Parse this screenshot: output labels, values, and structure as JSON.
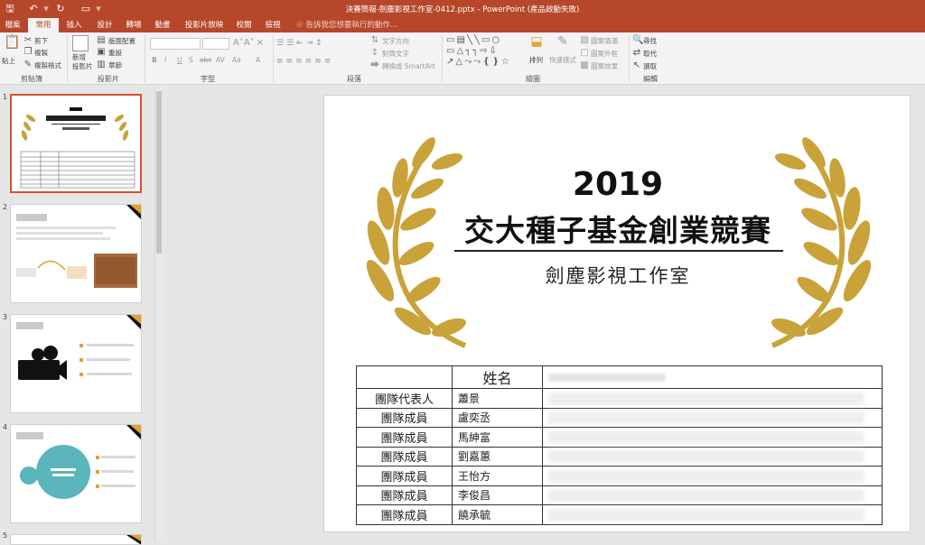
{
  "titlebar": {
    "title": "決賽簡報-劍塵影視工作室-0412.pptx - PowerPoint (產品啟動失敗)",
    "quick_access": [
      "save-icon",
      "undo-icon",
      "redo-icon",
      "start-from-beginning-icon"
    ]
  },
  "tabs": [
    {
      "label": "檔案",
      "active": false
    },
    {
      "label": "常用",
      "active": true
    },
    {
      "label": "插入",
      "active": false
    },
    {
      "label": "設計",
      "active": false
    },
    {
      "label": "轉場",
      "active": false
    },
    {
      "label": "動畫",
      "active": false
    },
    {
      "label": "投影片放映",
      "active": false
    },
    {
      "label": "校閱",
      "active": false
    },
    {
      "label": "檢視",
      "active": false
    }
  ],
  "tell_me": "告訴我您想要執行的動作...",
  "ribbon": {
    "clipboard": {
      "paste": "貼上",
      "cut": "剪下",
      "copy": "複製",
      "format_painter": "複製格式",
      "label": "剪貼簿"
    },
    "slides": {
      "new_slide": "新增\n投影片",
      "layout": "版面配置",
      "reset": "重設",
      "section": "章節",
      "label": "投影片"
    },
    "font": {
      "bold": "B",
      "italic": "I",
      "underline": "U",
      "shadow": "S",
      "strike": "abc",
      "spacing": "AV",
      "case": "Aa",
      "color": "A",
      "label": "字型"
    },
    "paragraph": {
      "text_direction": "文字方向",
      "align_text": "對齊文字",
      "smartart": "轉換成 SmartArt",
      "label": "段落"
    },
    "drawing": {
      "arrange": "排列",
      "quick_styles": "快速樣式",
      "shape_fill": "圖案填滿",
      "shape_outline": "圖案外框",
      "shape_effects": "圖案效果",
      "label": "繪圖"
    },
    "editing": {
      "find": "尋找",
      "replace": "取代",
      "select": "選取",
      "label": "編輯"
    }
  },
  "thumbnails": [
    {
      "num": "1",
      "selected": true
    },
    {
      "num": "2",
      "selected": false
    },
    {
      "num": "3",
      "selected": false
    },
    {
      "num": "4",
      "selected": false
    },
    {
      "num": "5",
      "selected": false
    }
  ],
  "slide": {
    "year": "2019",
    "title": "交大種子基金創業競賽",
    "subtitle": "劍塵影視工作室",
    "table": {
      "header_name": "姓名",
      "rows": [
        {
          "role": "團隊代表人",
          "name": "蕭景"
        },
        {
          "role": "團隊成員",
          "name": "盧奕丞"
        },
        {
          "role": "團隊成員",
          "name": "馬紳富"
        },
        {
          "role": "團隊成員",
          "name": "劉嘉蕙"
        },
        {
          "role": "團隊成員",
          "name": "王怡方"
        },
        {
          "role": "團隊成員",
          "name": "李俊昌"
        },
        {
          "role": "團隊成員",
          "name": "饒承毓"
        }
      ]
    }
  },
  "colors": {
    "accent": "#b7472a",
    "laurel": "#c9a23a",
    "selection": "#d35230"
  }
}
